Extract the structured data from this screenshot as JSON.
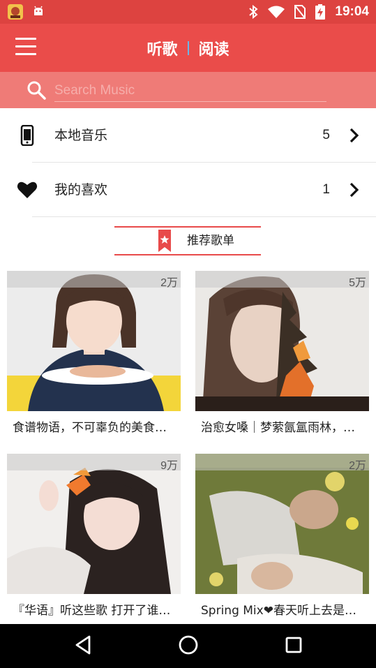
{
  "status_bar": {
    "time": "19:04",
    "left_icons": [
      "game-app-icon",
      "android-notification-icon"
    ],
    "right_icons": [
      "bluetooth-icon",
      "wifi-icon",
      "no-sim-icon",
      "battery-charging-icon"
    ]
  },
  "app_bar": {
    "menu_icon": "hamburger-menu-icon",
    "tabs": [
      {
        "label": "听歌",
        "active": true
      },
      {
        "label": "阅读",
        "active": false
      }
    ]
  },
  "search": {
    "placeholder": "Search Music",
    "icon": "search-icon"
  },
  "library": {
    "items": [
      {
        "label": "本地音乐",
        "count": "5",
        "icon": "phone-icon"
      },
      {
        "label": "我的喜欢",
        "count": "1",
        "icon": "heart-icon"
      }
    ]
  },
  "recommend": {
    "title": "推荐歌单",
    "icon": "bookmark-star-icon"
  },
  "playlists": [
    {
      "title": "食谱物语，不可辜负的美食…",
      "play_count": "2万"
    },
    {
      "title": "治愈女嗓｜梦萦氤氲雨林，…",
      "play_count": "5万"
    },
    {
      "title": "『华语』听这些歌 打开了谁…",
      "play_count": "9万"
    },
    {
      "title": "Spring Mix❤春天听上去是…",
      "play_count": "2万"
    }
  ],
  "colors": {
    "status_bar": "#dd4340",
    "app_bar": "#ea4c4a",
    "search_bar": "#ef7b77",
    "accent": "#e84a4a"
  },
  "nav_bar": {
    "buttons": [
      "back-icon",
      "home-icon",
      "recents-icon"
    ]
  }
}
